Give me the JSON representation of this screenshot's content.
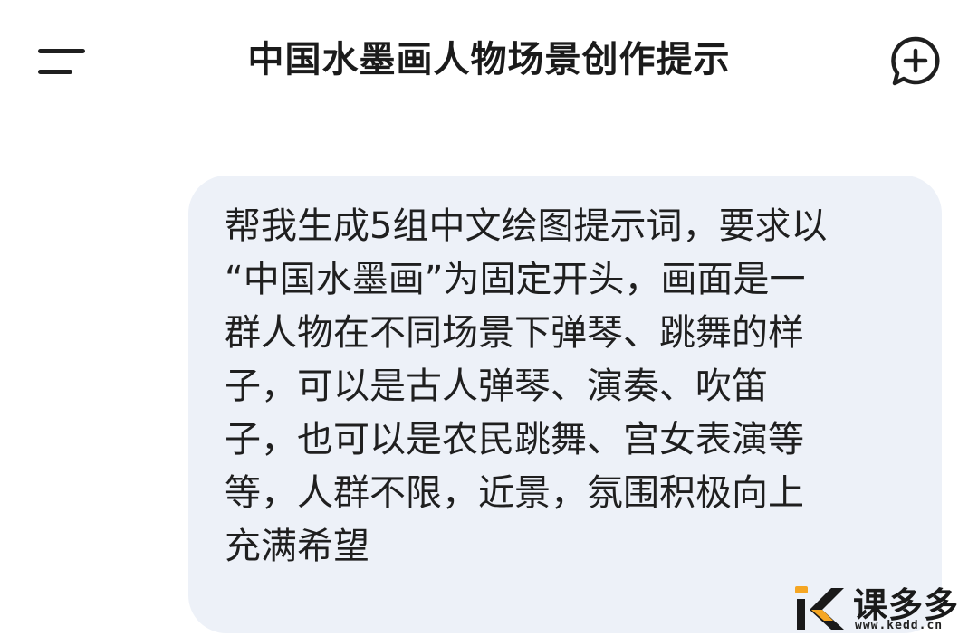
{
  "header": {
    "title": "中国水墨画人物场景创作提示",
    "menu_icon": "menu-icon",
    "new_chat_icon": "chat-plus-icon"
  },
  "message": {
    "role": "user",
    "text": "帮我生成5组中文绘图提示词，要求以\n“中国水墨画”为固定开头，画面是一\n群人物在不同场景下弹琴、跳舞的样\n子，可以是古人弹琴、演奏、吹笛\n子，也可以是农民跳舞、宫女表演等\n等，人群不限，近景，氛围积极向上\n充满希望"
  },
  "watermark": {
    "name": "课多多",
    "url": "www.kedd.cn"
  },
  "colors": {
    "bubble_bg": "#edf1f8",
    "text": "#1f1f1f",
    "accent": "#f5a623"
  }
}
